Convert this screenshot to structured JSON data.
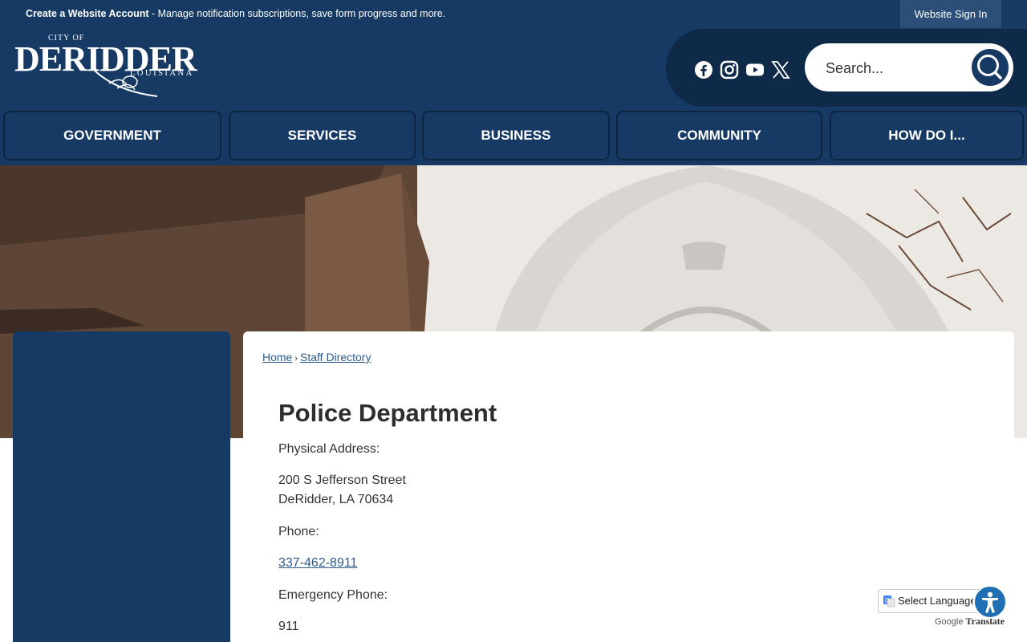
{
  "topbar": {
    "account_link": "Create a Website Account",
    "account_desc": " - Manage notification subscriptions, save form progress and more.",
    "signin": "Website Sign In"
  },
  "logo": {
    "city_of": "CITY OF",
    "name": "DERIDDER",
    "state": "LOUISIANA"
  },
  "social": [
    "facebook-icon",
    "instagram-icon",
    "youtube-icon",
    "x-icon"
  ],
  "search": {
    "placeholder": "Search..."
  },
  "nav": [
    {
      "label": "GOVERNMENT"
    },
    {
      "label": "SERVICES"
    },
    {
      "label": "BUSINESS"
    },
    {
      "label": "COMMUNITY"
    },
    {
      "label": "HOW DO I..."
    }
  ],
  "breadcrumb": {
    "home": "Home",
    "separator": "›",
    "current": "Staff Directory"
  },
  "department": {
    "title": "Police Department",
    "address_label": "Physical Address:",
    "address_line1": "200 S Jefferson Street",
    "address_line2": "DeRidder, LA 70634",
    "phone_label": "Phone:",
    "phone": "337-462-8911",
    "emergency_label": "Emergency Phone:",
    "emergency": "911"
  },
  "translate": {
    "select": "Select Language",
    "google": "Google",
    "translate": "Translate"
  },
  "colors": {
    "navy": "#163a63",
    "link": "#2d5a8a"
  }
}
